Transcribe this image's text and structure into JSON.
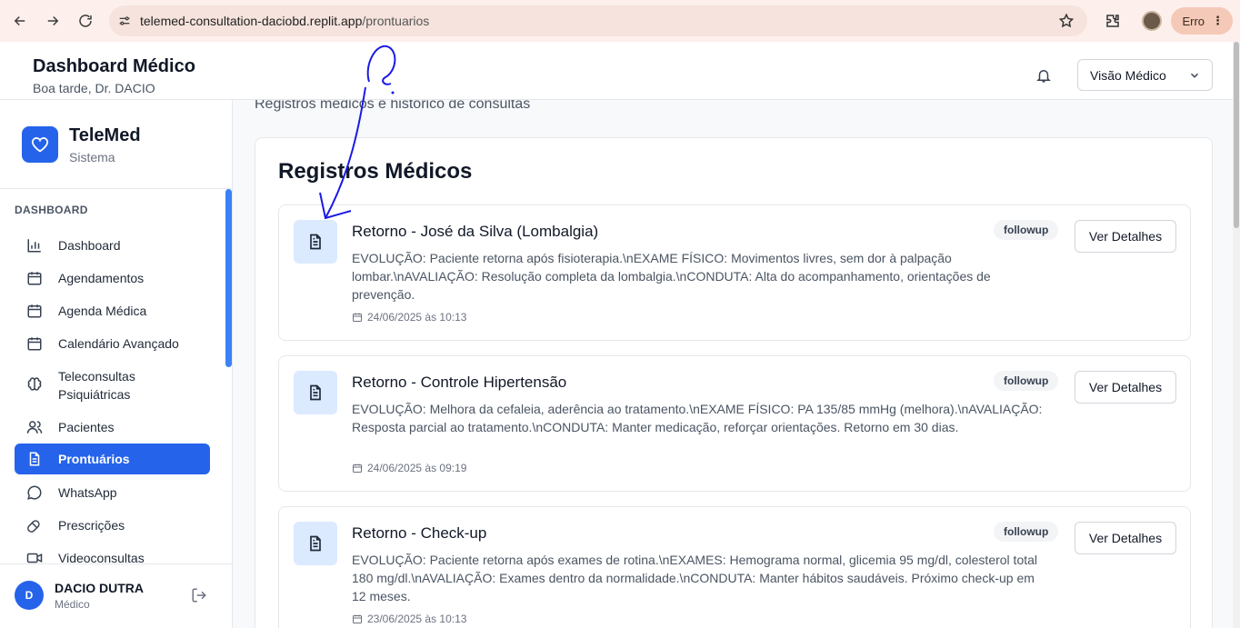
{
  "browser": {
    "url_domain": "telemed-consultation-daciobd.replit.app",
    "url_path": "/prontuarios",
    "profile_status": "Erro"
  },
  "header": {
    "title": "Dashboard Médico",
    "greeting": "Boa tarde, Dr. DACIO",
    "view_select": "Visão Médico"
  },
  "sidebar": {
    "brand_name": "TeleMed",
    "brand_sub": "Sistema",
    "section_label": "DASHBOARD",
    "items": [
      {
        "label": "Dashboard",
        "icon": "bar-chart-icon"
      },
      {
        "label": "Agendamentos",
        "icon": "calendar-icon"
      },
      {
        "label": "Agenda Médica",
        "icon": "calendar-icon"
      },
      {
        "label": "Calendário Avançado",
        "icon": "calendar-icon"
      },
      {
        "label": "Teleconsultas Psiquiátricas",
        "icon": "brain-icon"
      },
      {
        "label": "Pacientes",
        "icon": "users-icon"
      },
      {
        "label": "Prontuários",
        "icon": "file-icon",
        "active": true
      },
      {
        "label": "WhatsApp",
        "icon": "message-circle-icon"
      },
      {
        "label": "Prescrições",
        "icon": "pill-icon"
      },
      {
        "label": "Videoconsultas",
        "icon": "video-icon"
      }
    ],
    "user": {
      "initial": "D",
      "name": "DACIO DUTRA",
      "role": "Médico"
    }
  },
  "main": {
    "subtitle": "Registros médicos e histórico de consultas",
    "card_title": "Registros Médicos",
    "records": [
      {
        "title": "Retorno - José da Silva (Lombalgia)",
        "description": "EVOLUÇÃO: Paciente retorna após fisioterapia.\\nEXAME FÍSICO: Movimentos livres, sem dor à palpação lombar.\\nAVALIAÇÃO: Resolução completa da lombalgia.\\nCONDUTA: Alta do acompanhamento, orientações de prevenção.",
        "date": "24/06/2025 às 10:13",
        "badge": "followup",
        "button": "Ver Detalhes"
      },
      {
        "title": "Retorno - Controle Hipertensão",
        "description": "EVOLUÇÃO: Melhora da cefaleia, aderência ao tratamento.\\nEXAME FÍSICO: PA 135/85 mmHg (melhora).\\nAVALIAÇÃO: Resposta parcial ao tratamento.\\nCONDUTA: Manter medicação, reforçar orientações. Retorno em 30 dias.",
        "date": "24/06/2025 às 09:19",
        "badge": "followup",
        "button": "Ver Detalhes"
      },
      {
        "title": "Retorno - Check-up",
        "description": "EVOLUÇÃO: Paciente retorna após exames de rotina.\\nEXAMES: Hemograma normal, glicemia 95 mg/dl, colesterol total 180 mg/dl.\\nAVALIAÇÃO: Exames dentro da normalidade.\\nCONDUTA: Manter hábitos saudáveis. Próximo check-up em 12 meses.",
        "date": "23/06/2025 às 10:13",
        "badge": "followup",
        "button": "Ver Detalhes"
      }
    ]
  }
}
